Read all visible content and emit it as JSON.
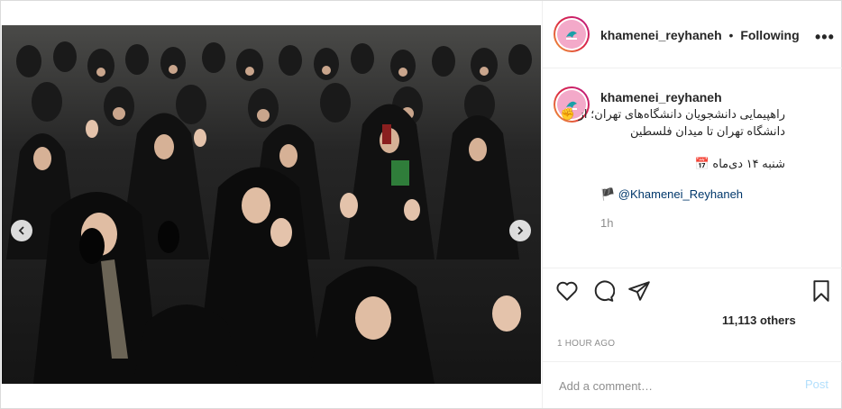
{
  "post": {
    "username": "khamenei_reyhaneh",
    "follow_separator": "•",
    "follow_status": "Following",
    "more_label": "•••"
  },
  "caption": {
    "username": "khamenei_reyhaneh",
    "line1": "راهپیمایی دانشجویان دانشگاه‌های تهران؛ از ✊",
    "line2": "دانشگاه تهران تا میدان فلسطین",
    "date_line": "شنبه ۱۴ دی‌ماه 📅",
    "handle": "🏴 @Khamenei_Reyhaneh",
    "time": "1h"
  },
  "actions": {
    "likes_text": "11,113 others",
    "timeago": "1 HOUR AGO"
  },
  "comment": {
    "placeholder": "Add a comment…",
    "post_label": "Post"
  },
  "carousel": {
    "total_slides": 9,
    "active_slide": 8
  },
  "colors": {
    "link": "#00376b",
    "muted": "#8e8e8e",
    "post_disabled": "#b2dffc",
    "border": "#dbdbdb"
  }
}
